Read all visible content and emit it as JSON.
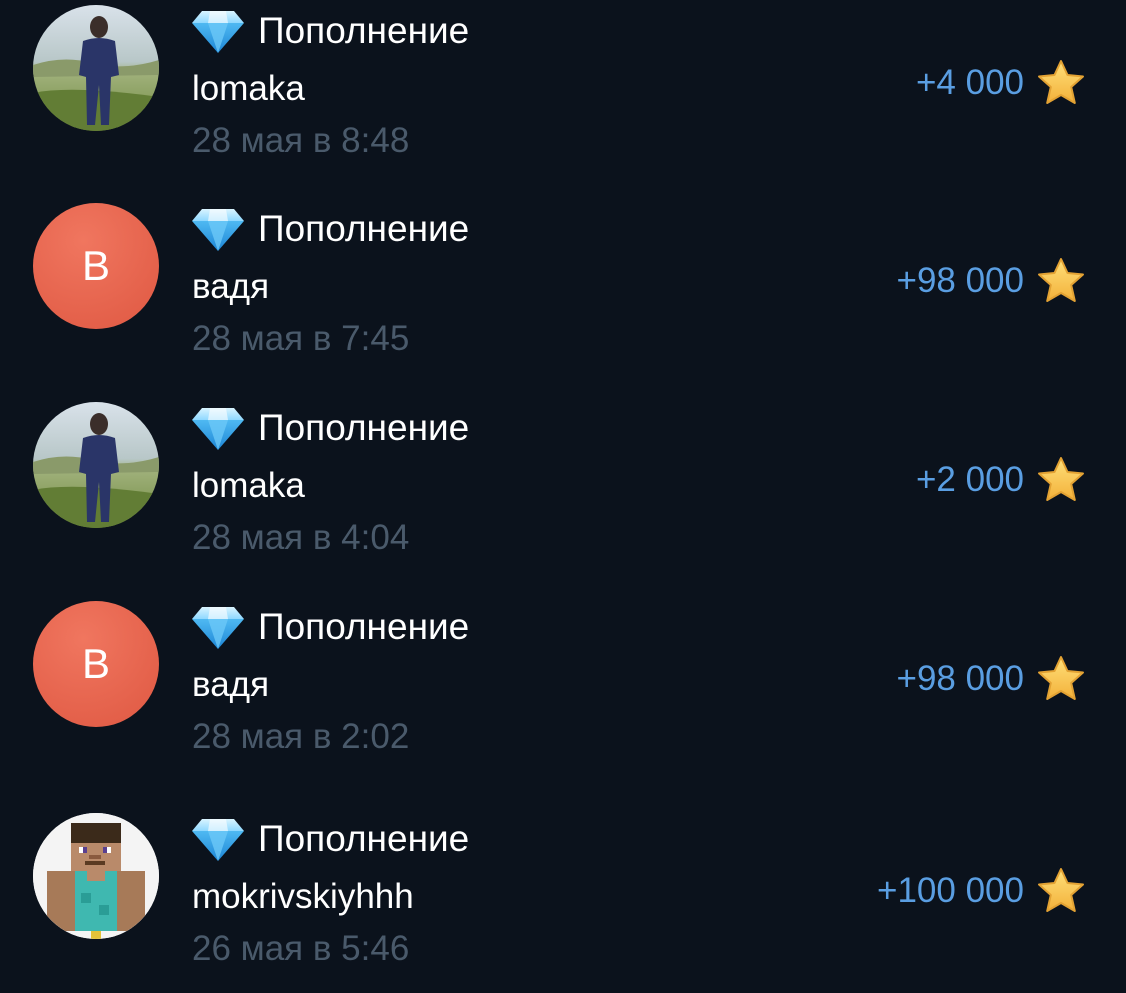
{
  "colors": {
    "background": "#0b121c",
    "amount": "#5a9ee2",
    "date": "#4a5a6b",
    "letter_avatar": "#e5604e",
    "star": "#f7c84a"
  },
  "transactions": [
    {
      "icon": "diamond-icon",
      "title": "Пополнение",
      "sender": "lomaka",
      "date": "28 мая в 8:48",
      "amount": "+4 000",
      "currency_icon": "star-icon",
      "avatar": {
        "type": "photo"
      }
    },
    {
      "icon": "diamond-icon",
      "title": "Пополнение",
      "sender": "вадя",
      "date": "28 мая в 7:45",
      "amount": "+98 000",
      "currency_icon": "star-icon",
      "avatar": {
        "type": "letter",
        "letter": "В"
      }
    },
    {
      "icon": "diamond-icon",
      "title": "Пополнение",
      "sender": "lomaka",
      "date": "28 мая в 4:04",
      "amount": "+2 000",
      "currency_icon": "star-icon",
      "avatar": {
        "type": "photo"
      }
    },
    {
      "icon": "diamond-icon",
      "title": "Пополнение",
      "sender": "вадя",
      "date": "28 мая в 2:02",
      "amount": "+98 000",
      "currency_icon": "star-icon",
      "avatar": {
        "type": "letter",
        "letter": "В"
      }
    },
    {
      "icon": "diamond-icon",
      "title": "Пополнение",
      "sender": "mokrivskiyhhh",
      "date": "26 мая в 5:46",
      "amount": "+100 000",
      "currency_icon": "star-icon",
      "avatar": {
        "type": "pixel-character"
      }
    }
  ]
}
